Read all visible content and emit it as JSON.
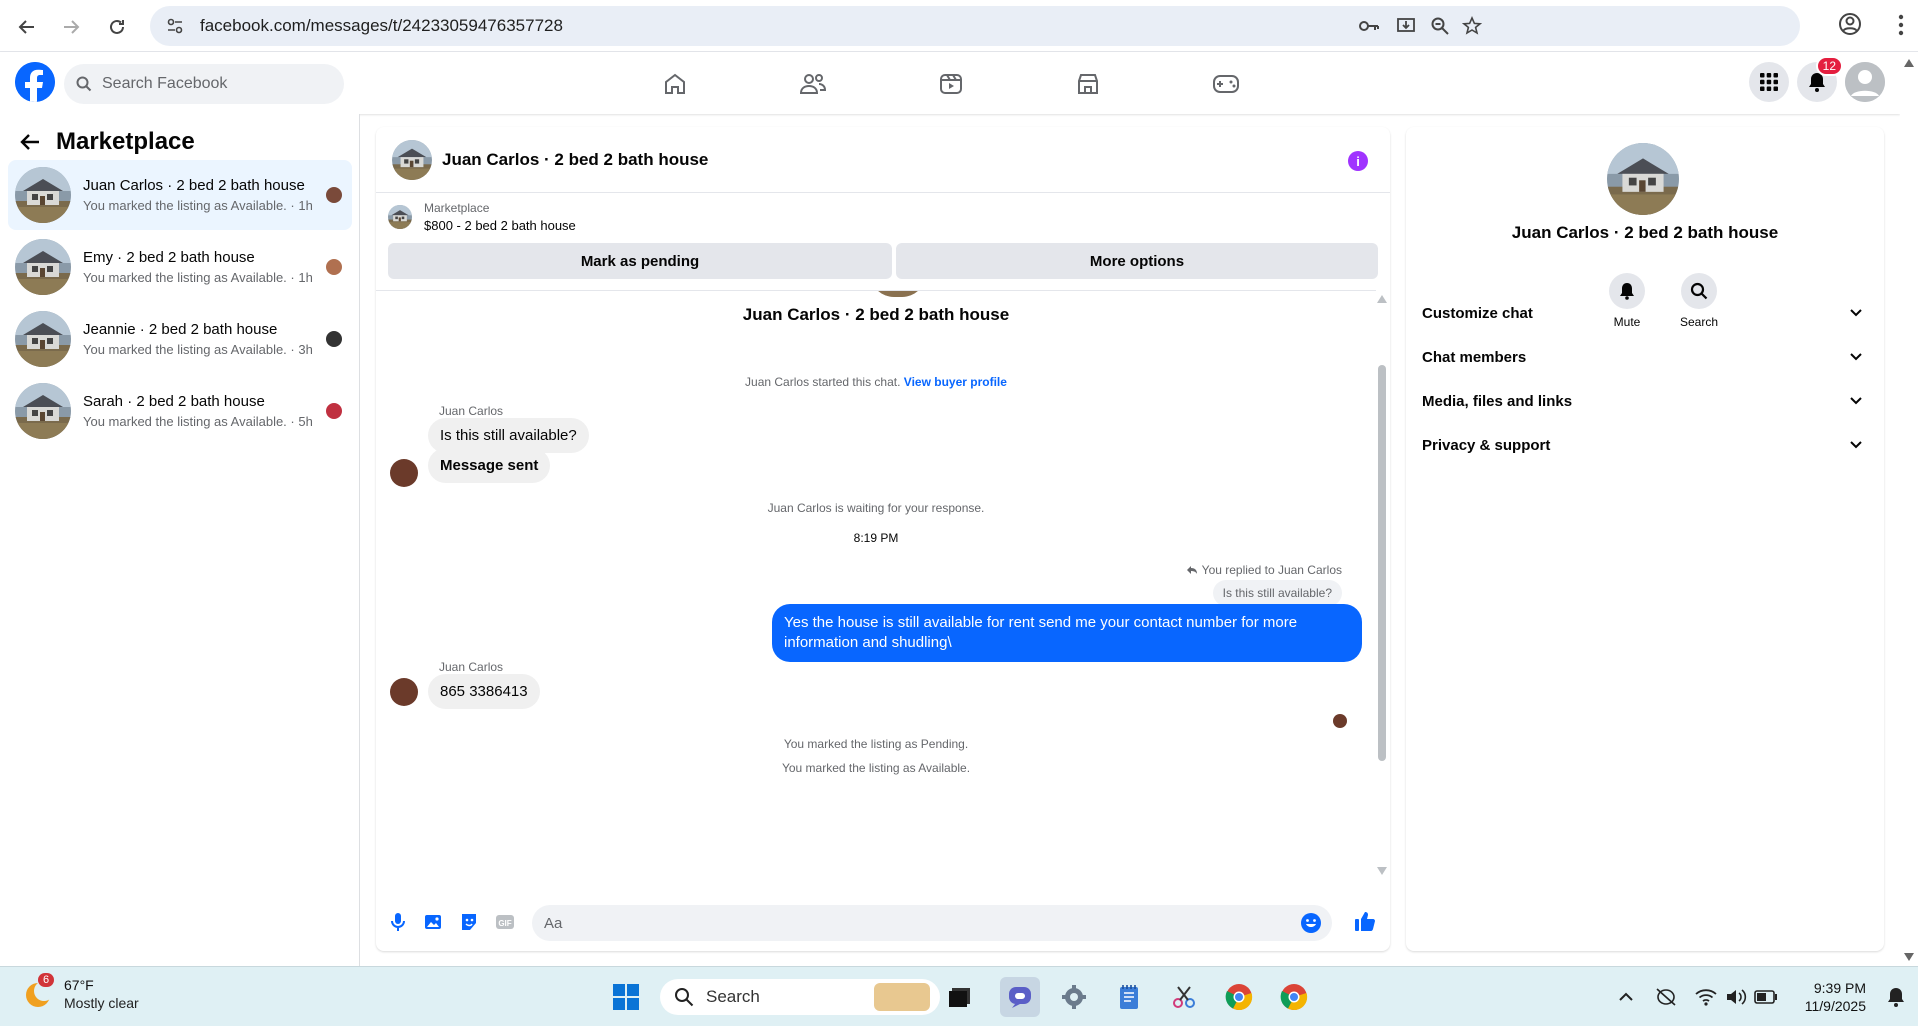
{
  "browser": {
    "url": "facebook.com/messages/t/24233059476357728"
  },
  "header": {
    "search_placeholder": "Search Facebook",
    "notifications_count": "12"
  },
  "left_panel": {
    "title": "Marketplace",
    "conversations": [
      {
        "name": "Juan Carlos · 2 bed 2 bath house",
        "status": "You marked the listing as Available. · 1h"
      },
      {
        "name": "Emy · 2 bed 2 bath house",
        "status": "You marked the listing as Available. · 1h"
      },
      {
        "name": "Jeannie · 2 bed 2 bath house",
        "status": "You marked the listing as Available. · 3h"
      },
      {
        "name": "Sarah · 2 bed 2 bath house",
        "status": "You marked the listing as Available. · 5h"
      }
    ]
  },
  "chat": {
    "title": "Juan Carlos · 2 bed 2 bath house",
    "listing_label": "Marketplace",
    "listing_price": "$800 - 2 bed 2 bath house",
    "mark_pending_label": "Mark as pending",
    "more_options_label": "More options",
    "intro_title": "Juan Carlos · 2 bed 2 bath house",
    "started_text": "Juan Carlos started this chat.",
    "view_profile_link": "View buyer profile",
    "sender_name_1": "Juan Carlos",
    "msg_1": "Is this still available?",
    "msg_2": "Message sent",
    "waiting_text": "Juan Carlos is waiting for your response.",
    "timestamp": "8:19 PM",
    "replied_to": "You replied to Juan Carlos",
    "quoted_msg": "Is this still available?",
    "my_reply": "Yes the house is still available for rent send me your contact number for more information and shudling\\",
    "sender_name_2": "Juan Carlos",
    "msg_3": "865 3386413",
    "status_pending": "You marked the listing as Pending.",
    "status_available": "You marked the listing as Available.",
    "composer_placeholder": "Aa"
  },
  "right_panel": {
    "title": "Juan Carlos · 2 bed 2 bath house",
    "mute_label": "Mute",
    "search_label": "Search",
    "sections": [
      "Customize chat",
      "Chat members",
      "Media, files and links",
      "Privacy & support"
    ]
  },
  "taskbar": {
    "temperature": "67°F",
    "weather": "Mostly clear",
    "weather_badge": "6",
    "search_label": "Search",
    "time": "9:39 PM",
    "date": "11/9/2025"
  },
  "colors": {
    "brand": "#0866ff",
    "info_purple": "#a033ff",
    "active_conv_bg": "#ebf5ff"
  }
}
